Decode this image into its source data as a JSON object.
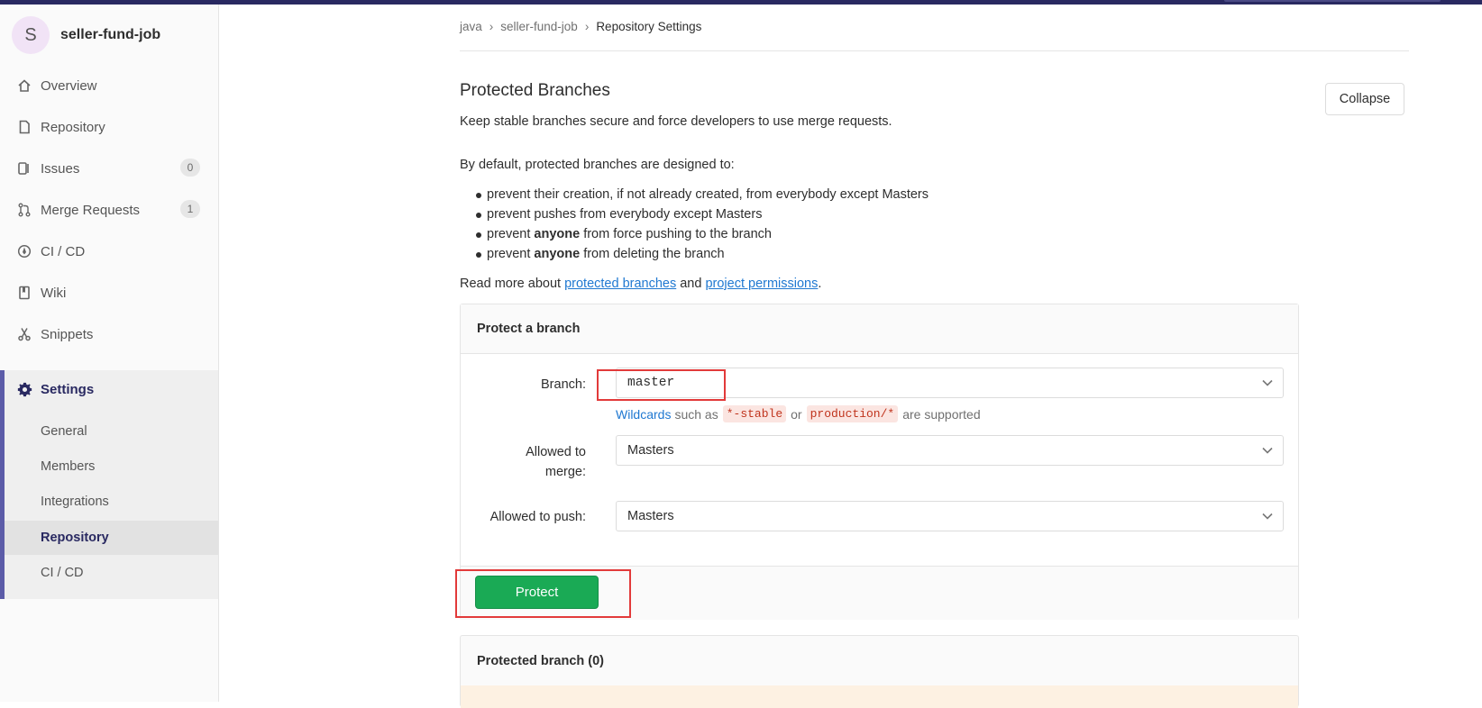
{
  "project": {
    "avatar_letter": "S",
    "name": "seller-fund-job"
  },
  "sidebar": {
    "items": [
      {
        "label": "Overview",
        "icon": "home-icon"
      },
      {
        "label": "Repository",
        "icon": "doc-icon"
      },
      {
        "label": "Issues",
        "icon": "issues-icon",
        "badge": "0"
      },
      {
        "label": "Merge Requests",
        "icon": "merge-icon",
        "badge": "1"
      },
      {
        "label": "CI / CD",
        "icon": "rocket-icon"
      },
      {
        "label": "Wiki",
        "icon": "book-icon"
      },
      {
        "label": "Snippets",
        "icon": "scissors-icon"
      },
      {
        "label": "Settings",
        "icon": "gear-icon"
      }
    ],
    "settings_sub": [
      "General",
      "Members",
      "Integrations",
      "Repository",
      "CI / CD"
    ],
    "active_sub": "Repository"
  },
  "breadcrumb": {
    "group": "java",
    "project": "seller-fund-job",
    "current": "Repository Settings"
  },
  "section": {
    "title": "Protected Branches",
    "description": "Keep stable branches secure and force developers to use merge requests.",
    "collapse_label": "Collapse",
    "defaults_intro": "By default, protected branches are designed to:",
    "bullets": [
      {
        "pre": "prevent their creation, if not already created, from everybody except Masters",
        "bold": "",
        "post": ""
      },
      {
        "pre": "prevent pushes from everybody except Masters",
        "bold": "",
        "post": ""
      },
      {
        "pre": "prevent ",
        "bold": "anyone",
        "post": " from force pushing to the branch"
      },
      {
        "pre": "prevent ",
        "bold": "anyone",
        "post": " from deleting the branch"
      }
    ],
    "read_more_pre": "Read more about ",
    "link1": "protected branches",
    "read_more_mid": " and ",
    "link2": "project permissions",
    "read_more_end": "."
  },
  "protect_form": {
    "title": "Protect a branch",
    "branch_label": "Branch:",
    "branch_value": "master",
    "hint_link": "Wildcards",
    "hint_such_as": "such as",
    "hint_code1": "*-stable",
    "hint_or": "or",
    "hint_code2": "production/*",
    "hint_end": "are supported",
    "merge_label_1": "Allowed to",
    "merge_label_2": "merge:",
    "merge_value": "Masters",
    "push_label": "Allowed to push:",
    "push_value": "Masters",
    "submit_label": "Protect"
  },
  "protected_list": {
    "title": "Protected branch (0)"
  },
  "colors": {
    "accent": "#292961",
    "success": "#1aaa55",
    "link": "#1f78d1",
    "highlight": "#e23a3a"
  }
}
